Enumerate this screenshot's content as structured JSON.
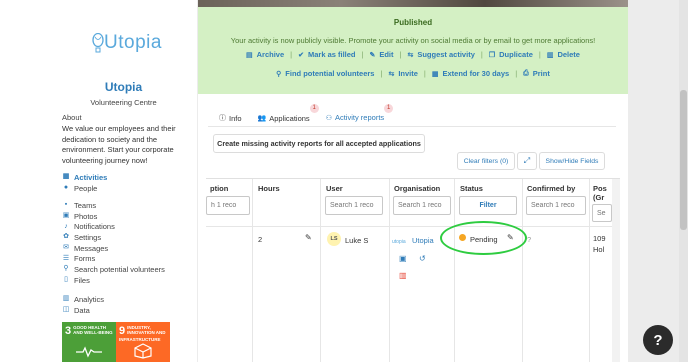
{
  "sidebar": {
    "logo_text": "Utopia",
    "org_name": "Utopia",
    "org_subtitle": "Volunteering Centre",
    "about_heading": "About",
    "about_text": "We value our employees and their dedication to society and the environment. Start your corporate volunteering journey now!",
    "nav_group1": [
      {
        "label": "Activities",
        "icon": "calendar-icon",
        "active": true
      },
      {
        "label": "People",
        "icon": "people-icon",
        "active": false
      }
    ],
    "nav_group2": [
      {
        "label": "Teams",
        "icon": "teams-icon"
      },
      {
        "label": "Photos",
        "icon": "photos-icon"
      },
      {
        "label": "Notifications",
        "icon": "bell-icon"
      },
      {
        "label": "Settings",
        "icon": "gear-icon"
      },
      {
        "label": "Messages",
        "icon": "messages-icon"
      },
      {
        "label": "Forms",
        "icon": "forms-icon"
      },
      {
        "label": "Search potential volunteers",
        "icon": "search-icon"
      },
      {
        "label": "Files",
        "icon": "file-icon"
      }
    ],
    "nav_group3": [
      {
        "label": "Analytics",
        "icon": "chart-icon"
      },
      {
        "label": "Data",
        "icon": "database-icon"
      }
    ],
    "sdg": [
      {
        "num": "3",
        "label": "GOOD HEALTH AND WELL-BEING",
        "color": "#4c9f38"
      },
      {
        "num": "9",
        "label": "INDUSTRY, INNOVATION AND INFRASTRUCTURE",
        "color": "#fd6925"
      }
    ]
  },
  "banner": {
    "title": "Published",
    "message": "Your activity is now publicly visible. Promote your activity on social media or by email to get more applications!",
    "row1": [
      {
        "label": "Archive",
        "icon": "archive-icon"
      },
      {
        "label": "Mark as filled",
        "icon": "check-icon"
      },
      {
        "label": "Edit",
        "icon": "edit-icon"
      },
      {
        "label": "Suggest activity",
        "icon": "share-icon"
      },
      {
        "label": "Duplicate",
        "icon": "copy-icon"
      },
      {
        "label": "Delete",
        "icon": "trash-icon"
      }
    ],
    "row2": [
      {
        "label": "Find potential volunteers",
        "icon": "search-icon"
      },
      {
        "label": "Invite",
        "icon": "share-icon"
      },
      {
        "label": "Extend for 30 days",
        "icon": "calendar-icon"
      },
      {
        "label": "Print",
        "icon": "print-icon"
      }
    ]
  },
  "tabs": [
    {
      "label": "Info",
      "icon": "info-icon",
      "badge": ""
    },
    {
      "label": "Applications",
      "icon": "people-icon",
      "badge": "1"
    },
    {
      "label": "Activity reports",
      "icon": "user-check-icon",
      "badge": "1"
    }
  ],
  "buttons": {
    "create": "Create missing activity reports for all accepted applications",
    "clear_filters": "Clear filters (0)",
    "show_hide": "Show/Hide Fields"
  },
  "table": {
    "headers": {
      "description": "ption",
      "hours": "Hours",
      "user": "User",
      "organisation": "Organisation",
      "status": "Status",
      "confirmed_by": "Confirmed by",
      "position": "Pos",
      "position2": "(Gr"
    },
    "filters": {
      "description_ph": "h 1 reco",
      "user_ph": "Search 1 reco",
      "organisation_ph": "Search 1 reco",
      "status_btn": "Filter",
      "confirmed_ph": "Search 1 reco",
      "position_ph": "Se"
    },
    "row": {
      "hours": "2",
      "user_initials": "LS",
      "user_name": "Luke S",
      "organisation": "Utopia",
      "status": "Pending",
      "confirmed_by": "?",
      "position": "109",
      "position2": "Hol"
    }
  },
  "help": "?"
}
